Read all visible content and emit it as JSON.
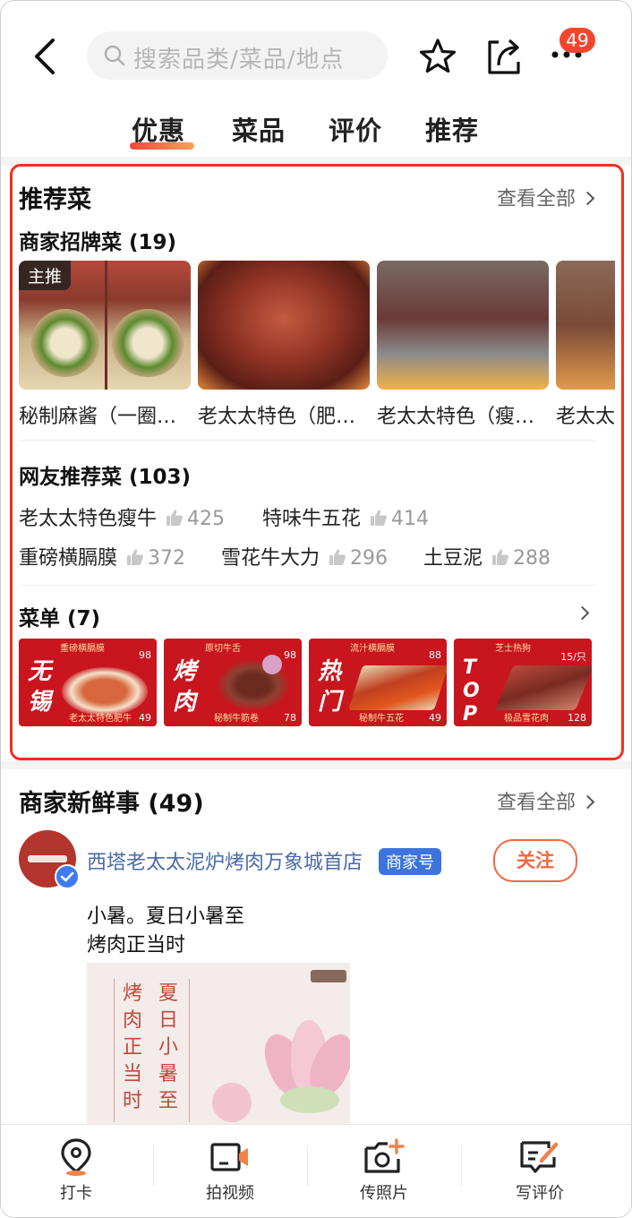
{
  "header": {
    "search_placeholder": "搜索品类/菜品/地点",
    "notification_count": "49"
  },
  "tabs": [
    {
      "label": "优惠",
      "active": true
    },
    {
      "label": "菜品"
    },
    {
      "label": "评价"
    },
    {
      "label": "推荐"
    }
  ],
  "recommended": {
    "title": "推荐菜",
    "view_all": "查看全部",
    "signature": {
      "title": "商家招牌菜 (19)",
      "dishes": [
        {
          "name": "秘制麻酱（一圈…",
          "tag": "主推"
        },
        {
          "name": "老太太特色（肥…"
        },
        {
          "name": "老太太特色（瘦…"
        },
        {
          "name": "老太太"
        }
      ]
    },
    "netizen": {
      "title": "网友推荐菜 (103)",
      "items": [
        {
          "name": "老太太特色瘦牛",
          "count": "425"
        },
        {
          "name": "特味牛五花",
          "count": "414"
        },
        {
          "name": "重磅横膈膜",
          "count": "372"
        },
        {
          "name": "雪花牛大力",
          "count": "296"
        },
        {
          "name": "土豆泥",
          "count": "288"
        }
      ]
    },
    "menu": {
      "title": "菜单 (7)",
      "cards": [
        {
          "big": "无锡",
          "top": "重磅横膈膜",
          "price1": "98",
          "bottom": "老太太特色肥牛",
          "price2": "49"
        },
        {
          "big": "烤肉",
          "top": "原切牛舌",
          "price1": "98",
          "bottom": "秘制牛筋卷",
          "price2": "78"
        },
        {
          "big": "热门",
          "top": "流汁横膈膜",
          "price1": "88",
          "bottom": "秘制牛五花",
          "price2": "49"
        },
        {
          "big": "TOP1",
          "top": "芝士热狗",
          "price1": "15/只",
          "bottom": "极品雪花肉",
          "price2": "128"
        }
      ]
    }
  },
  "news": {
    "title": "商家新鲜事 (49)",
    "view_all": "查看全部",
    "merchant_name": "西塔老太太泥炉烤肉万象城首店",
    "merchant_tag": "商家号",
    "follow_label": "关注",
    "post_line1": "小暑。夏日小暑至",
    "post_line2": "烤肉正当时",
    "poster_col1": "夏日小暑至",
    "poster_col2": "烤肉正当时"
  },
  "bottom_bar": [
    {
      "label": "打卡",
      "icon": "location-pin-icon"
    },
    {
      "label": "拍视频",
      "icon": "video-camera-icon"
    },
    {
      "label": "传照片",
      "icon": "add-photo-icon"
    },
    {
      "label": "写评价",
      "icon": "write-review-icon"
    }
  ],
  "colors": {
    "accent": "#f2301d",
    "badge": "#f5452c",
    "follow": "#f0683f",
    "merchant_link": "#4a6aa8",
    "menu_red": "#c8151e"
  }
}
